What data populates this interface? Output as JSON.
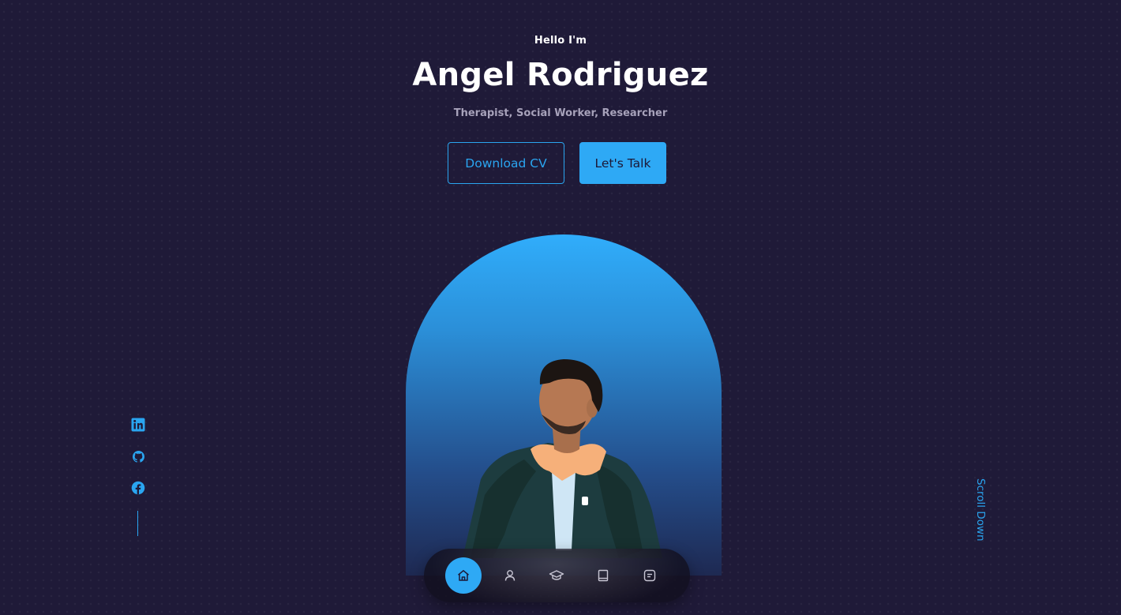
{
  "header": {
    "greeting": "Hello I'm",
    "name": "Angel Rodriguez",
    "roles": "Therapist, Social Worker, Researcher"
  },
  "actions": {
    "download_cv": "Download CV",
    "lets_talk": "Let's Talk"
  },
  "scroll": {
    "label": "Scroll Down"
  },
  "socials": [
    {
      "icon": "linkedin-icon"
    },
    {
      "icon": "github-icon"
    },
    {
      "icon": "facebook-icon"
    }
  ],
  "nav": [
    {
      "icon": "home-icon",
      "active": true
    },
    {
      "icon": "user-icon",
      "active": false
    },
    {
      "icon": "graduation-cap-icon",
      "active": false
    },
    {
      "icon": "book-icon",
      "active": false
    },
    {
      "icon": "message-icon",
      "active": false
    }
  ],
  "colors": {
    "background": "#1f1a38",
    "accent": "#2ea9f5",
    "text_muted": "#a7a2ba"
  }
}
